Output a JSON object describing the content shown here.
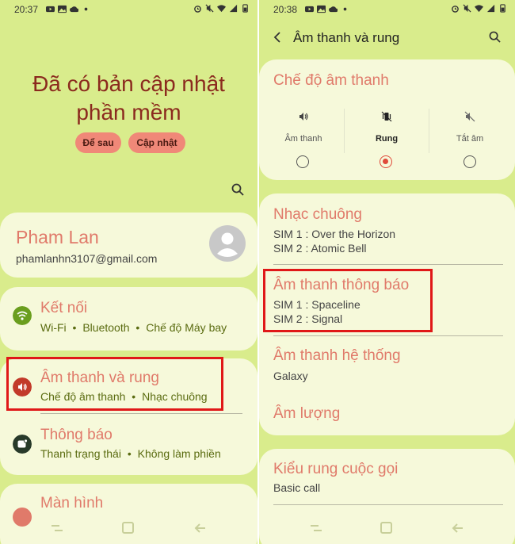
{
  "left": {
    "status": {
      "time": "20:37"
    },
    "update": {
      "title_line1": "Đã có bản cập nhật",
      "title_line2": "phần mềm",
      "later_label": "Để sau",
      "update_label": "Cập nhật"
    },
    "account": {
      "name": "Pham Lan",
      "email": "phamlanhn3107@gmail.com"
    },
    "items": [
      {
        "title": "Kết nối",
        "sub1": "Wi-Fi",
        "sub2": "Bluetooth",
        "sub3": "Chế độ Máy bay"
      },
      {
        "title": "Âm thanh và rung",
        "sub1": "Chế độ âm thanh",
        "sub2": "Nhạc chuông"
      },
      {
        "title": "Thông báo",
        "sub1": "Thanh trạng thái",
        "sub2": "Không làm phiền"
      },
      {
        "title": "Màn hình"
      }
    ],
    "separator": "•"
  },
  "right": {
    "status": {
      "time": "20:38"
    },
    "header": {
      "title": "Âm thanh và rung"
    },
    "sound_mode": {
      "title": "Chế độ âm thanh",
      "options": [
        {
          "label": "Âm thanh",
          "selected": false
        },
        {
          "label": "Rung",
          "selected": true
        },
        {
          "label": "Tắt âm",
          "selected": false
        }
      ]
    },
    "ringtone": {
      "title": "Nhạc chuông",
      "sim1": "SIM 1 : Over the Horizon",
      "sim2": "SIM 2 : Atomic Bell"
    },
    "notification_sound": {
      "title": "Âm thanh thông báo",
      "sim1": "SIM 1 : Spaceline",
      "sim2": "SIM 2 : Signal"
    },
    "system_sound": {
      "title": "Âm thanh hệ thống",
      "value": "Galaxy"
    },
    "volume": {
      "title": "Âm lượng"
    },
    "vibration": {
      "title": "Kiểu rung cuộc gọi",
      "value": "Basic call"
    }
  },
  "colors": {
    "background": "#d9ec8c",
    "card": "#f6f9da",
    "accent_title": "#e07a6a",
    "highlight": "#e01818",
    "pill": "#f08878"
  }
}
